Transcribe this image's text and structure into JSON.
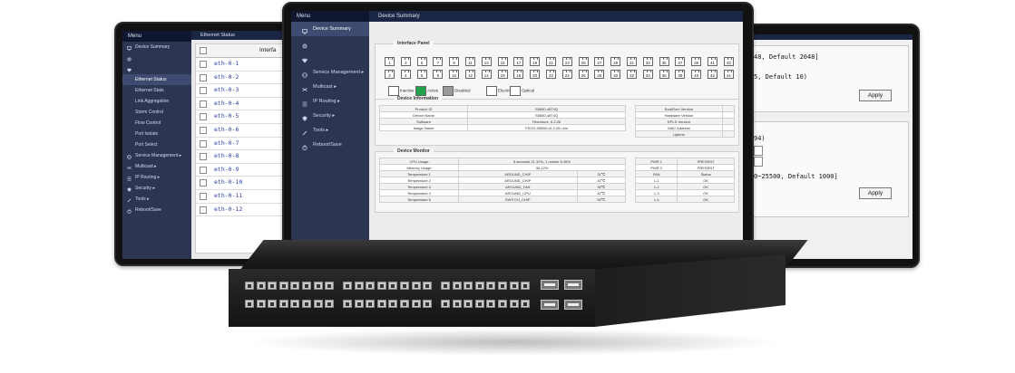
{
  "center": {
    "menu_label": "Menu",
    "page_title": "Device Summary",
    "nav": [
      {
        "label": "Device Summary",
        "icon": "monitor-icon",
        "active": true
      },
      {
        "label": "",
        "icon": "gear-icon"
      },
      {
        "label": "",
        "icon": "heart-icon"
      },
      {
        "label": "Service Management",
        "icon": "globe-icon"
      },
      {
        "label": "Multicast",
        "icon": "shuffle-icon"
      },
      {
        "label": "IP Routing",
        "icon": "list-icon"
      },
      {
        "label": "Security",
        "icon": "shield-icon"
      },
      {
        "label": "Tools",
        "icon": "tools-icon"
      },
      {
        "label": "Reboot/Save",
        "icon": "power-icon"
      }
    ],
    "interface_panel": {
      "title": "Interface Panel",
      "top_ports": [
        "1",
        "3",
        "5",
        "7",
        "9",
        "11",
        "13",
        "15",
        "17",
        "19",
        "21",
        "23",
        "25",
        "27",
        "29",
        "31",
        "33",
        "35",
        "37",
        "39",
        "41",
        "43"
      ],
      "bottom_ports": [
        "2",
        "4",
        "6",
        "8",
        "10",
        "12",
        "14",
        "16",
        "18",
        "20",
        "22",
        "24",
        "26",
        "28",
        "30",
        "32",
        "34",
        "36",
        "38",
        "40",
        "42",
        "44"
      ],
      "legend": [
        {
          "label": "Inactive",
          "color": "#ffffff"
        },
        {
          "label": "Active",
          "color": "#1fa34f"
        },
        {
          "label": "Disabled",
          "color": "#9a9a9a"
        },
        {
          "label": "Electrical",
          "color": "#ffffff"
        },
        {
          "label": "Optical",
          "color": "#ffffff"
        }
      ]
    },
    "device_information": {
      "title": "Device Information",
      "left": [
        [
          "Product ID",
          "S5850-48T4Q"
        ],
        [
          "Device Name",
          "S5850-48T4Q"
        ],
        [
          "Software",
          "Fiberstore, 6.2.26"
        ],
        [
          "Image Name",
          "FSOS-S5850-v6.2.26.r.bin"
        ]
      ],
      "right": [
        [
          "BootRom Version",
          ""
        ],
        [
          "Hardware Version",
          ""
        ],
        [
          "EPLD Version",
          ""
        ],
        [
          "MAC Address",
          ""
        ],
        [
          "Uptime",
          ""
        ]
      ]
    },
    "device_monitor": {
      "title": "Device Monitor",
      "usage": [
        [
          "CPU Usage",
          "5 seconds 21.31%, 1 minute 6.45%"
        ],
        [
          "Memory Usage",
          "30.12%"
        ]
      ],
      "temps": [
        [
          "Temperature 1",
          "AROUND_CHIP",
          "31℃"
        ],
        [
          "Temperature 2",
          "AROUND_CHIP",
          "41℃"
        ],
        [
          "Temperature 3",
          "AROUND_FAN",
          "35℃"
        ],
        [
          "Temperature 4",
          "AROUND_CPU",
          "41℃"
        ],
        [
          "Temperature 5",
          "SWITCH_CHIP",
          "59℃"
        ]
      ],
      "power": [
        [
          "PWR 1",
          "PRESENT"
        ],
        [
          "PWR 2",
          "PRESENT"
        ],
        [
          "FAN",
          "Status"
        ],
        [
          "1-1",
          "OK"
        ],
        [
          "1-2",
          "OK"
        ],
        [
          "1-3",
          "OK"
        ],
        [
          "1-4",
          "OK"
        ]
      ]
    }
  },
  "left": {
    "menu_label": "Menu",
    "page_title": "Ethernet Status",
    "nav": [
      {
        "label": "Device Summary",
        "icon": "monitor-icon"
      },
      {
        "label": "",
        "icon": "gear-icon"
      },
      {
        "label": "",
        "icon": "heart-icon"
      },
      {
        "label": "Ethernet Status",
        "icon": "",
        "active": true
      },
      {
        "label": "Ethernet Stats",
        "icon": ""
      },
      {
        "label": "Link Aggregation",
        "icon": ""
      },
      {
        "label": "Storm Control",
        "icon": ""
      },
      {
        "label": "Flow Control",
        "icon": ""
      },
      {
        "label": "Port Isolate",
        "icon": ""
      },
      {
        "label": "Port Select",
        "icon": ""
      },
      {
        "label": "Service Management",
        "icon": "globe-icon"
      },
      {
        "label": "Multicast",
        "icon": "shuffle-icon"
      },
      {
        "label": "IP Routing",
        "icon": "list-icon"
      },
      {
        "label": "Security",
        "icon": "shield-icon"
      },
      {
        "label": "Tools",
        "icon": "tools-icon"
      },
      {
        "label": "Reboot/Save",
        "icon": "power-icon"
      }
    ],
    "table_header": "Interfa",
    "interfaces": [
      "eth-0-1",
      "eth-0-2",
      "eth-0-3",
      "eth-0-4",
      "eth-0-5",
      "eth-0-6",
      "eth-0-7",
      "eth-0-8",
      "eth-0-9",
      "eth-0-10",
      "eth-0-11",
      "eth-0-12"
    ]
  },
  "right": {
    "line1": "48, Default 2048]",
    "line2": "5, Default 10)",
    "apply1": "Apply",
    "line3": "94)",
    "line4": "0~25500, Default 1000]",
    "apply2": "Apply"
  },
  "colors": {
    "sidebar": "#2c3552",
    "topbar": "#1b2544",
    "link": "#2b3fa8",
    "active_port": "#1fa34f"
  }
}
